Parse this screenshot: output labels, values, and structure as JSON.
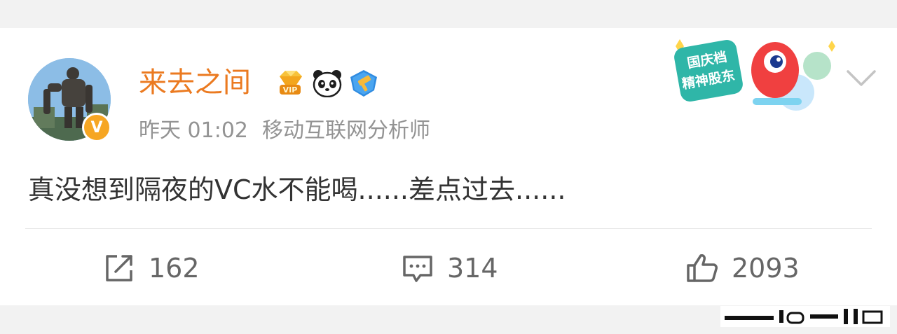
{
  "post": {
    "username": "来去之间",
    "time": "昨天 01:02",
    "source": "移动互联网分析师",
    "content": "真没想到隔夜的VC水不能喝......差点过去......",
    "verified_badge": "V",
    "badges": [
      "vip-diamond-icon",
      "panda-icon",
      "hammer-shield-icon"
    ],
    "promo": [
      "国庆档",
      "精神股东"
    ]
  },
  "actions": {
    "share_count": "162",
    "comment_count": "314",
    "like_count": "2093"
  },
  "colors": {
    "username": "#eb7a20",
    "meta": "#939393",
    "text": "#333333",
    "verified": "#f6a623"
  }
}
